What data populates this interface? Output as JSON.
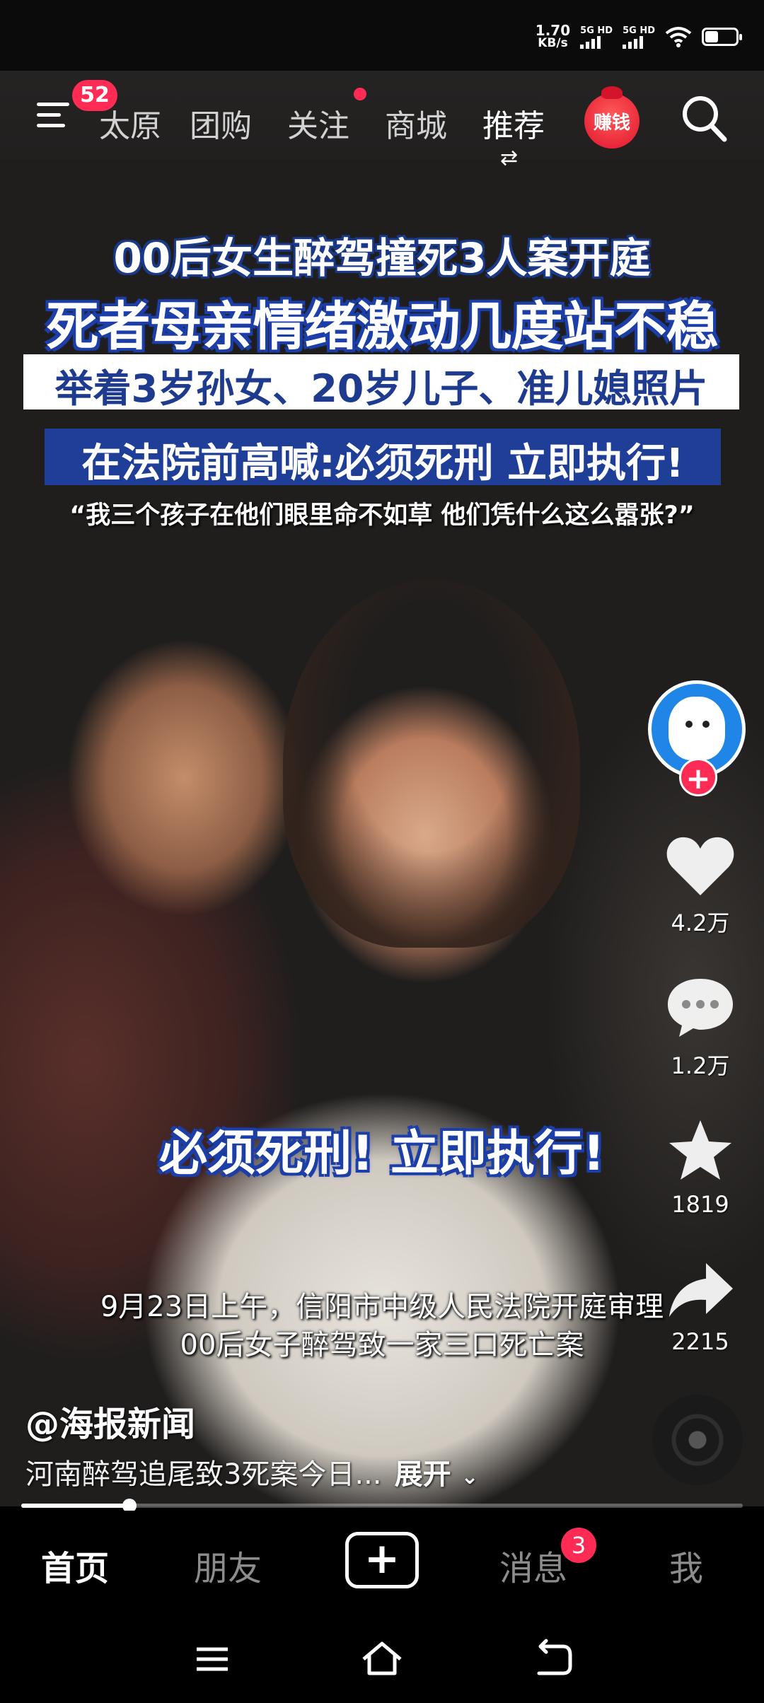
{
  "status": {
    "net_speed_value": "1.70",
    "net_speed_unit": "KB/s",
    "sim1": "5G HD",
    "sim2": "5G HD",
    "battery_level": 0.45
  },
  "topnav": {
    "menu_badge": "52",
    "tabs": [
      {
        "label": "太原"
      },
      {
        "label": "团购"
      },
      {
        "label": "关注"
      },
      {
        "label": "商城"
      },
      {
        "label": "推荐"
      }
    ],
    "earn_label": "赚钱"
  },
  "video": {
    "headline1": "00后女生醉驾撞死3人案开庭",
    "headline2": "死者母亲情绪激动几度站不稳",
    "headline3": "举着3岁孙女、20岁儿子、准儿媳照片",
    "headline4": "在法院前高喊:必须死刑 立即执行!",
    "quote": "“我三个孩子在他们眼里命不如草 他们凭什么这么嚣张?”",
    "shout": "必须死刑!  立即执行!",
    "subtitle1": "9月23日上午，信阳市中级人民法院开庭审理",
    "subtitle2": "00后女子醉驾致一家三口死亡案"
  },
  "rail": {
    "likes": "4.2万",
    "comments": "1.2万",
    "favorites": "1819",
    "shares": "2215"
  },
  "caption": {
    "author": "@海报新闻",
    "description": "河南醉驾追尾致3死案今日...",
    "expand": "展开",
    "progress": 0.15
  },
  "tabbar": {
    "home": "首页",
    "friends": "朋友",
    "messages": "消息",
    "messages_badge": "3",
    "me": "我"
  }
}
